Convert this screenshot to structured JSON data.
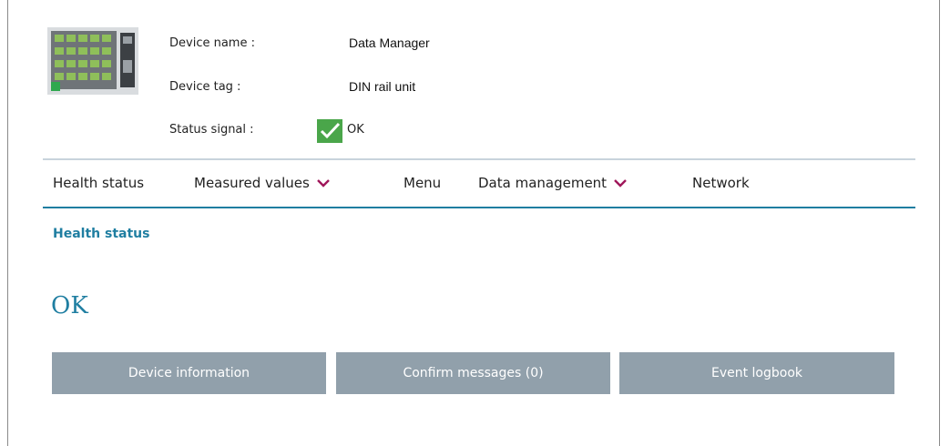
{
  "device": {
    "name_label": "Device name :",
    "name_value": "Data Manager",
    "tag_label": "Device tag :",
    "tag_value": "DIN rail unit",
    "status_label": "Status signal :",
    "status_value": "OK",
    "status_color": "#4aa64a"
  },
  "nav": {
    "items": [
      {
        "label": "Health status",
        "dropdown": false
      },
      {
        "label": "Measured values",
        "dropdown": true
      },
      {
        "label": "Menu",
        "dropdown": false
      },
      {
        "label": "Data management",
        "dropdown": true
      },
      {
        "label": "Network",
        "dropdown": false
      }
    ],
    "chevron_color": "#a0175a",
    "active_line_color": "#1f7ea1"
  },
  "page": {
    "breadcrumb": "Health status",
    "status_big": "OK"
  },
  "buttons": {
    "device_info": "Device information",
    "confirm_messages": "Confirm messages (0)",
    "event_logbook": "Event logbook"
  }
}
